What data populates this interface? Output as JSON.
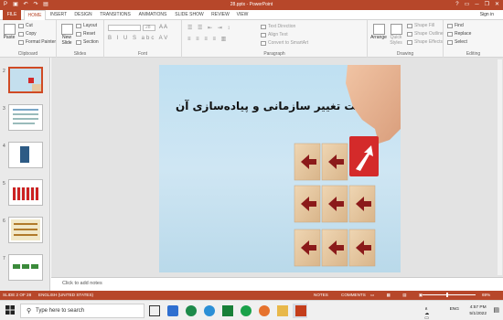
{
  "window": {
    "title": "28.pptx - PowerPoint",
    "minimize": "─",
    "restore": "❐",
    "close": "✕"
  },
  "tabs": [
    {
      "label": "FILE"
    },
    {
      "label": "HOME"
    },
    {
      "label": "INSERT"
    },
    {
      "label": "DESIGN"
    },
    {
      "label": "TRANSITIONS"
    },
    {
      "label": "ANIMATIONS"
    },
    {
      "label": "SLIDE SHOW"
    },
    {
      "label": "REVIEW"
    },
    {
      "label": "VIEW"
    }
  ],
  "active_tab": "HOME",
  "signin": "Sign in",
  "ribbon": {
    "clipboard": {
      "label": "Clipboard",
      "paste": "Paste",
      "cut": "Cut",
      "copy": "Copy",
      "format_painter": "Format Painter"
    },
    "slides": {
      "label": "Slides",
      "new_slide": "New Slide",
      "layout": "Layout",
      "reset": "Reset",
      "section": "Section"
    },
    "font": {
      "label": "Font",
      "size": "28"
    },
    "paragraph": {
      "label": "Paragraph",
      "text_direction": "Text Direction",
      "align_text": "Align Text",
      "convert_smartart": "Convert to SmartArt"
    },
    "drawing": {
      "label": "Drawing",
      "arrange": "Arrange",
      "quick_styles": "Quick Styles",
      "shape_fill": "Shape Fill",
      "shape_outline": "Shape Outline",
      "shape_effects": "Shape Effects"
    },
    "editing": {
      "label": "Editing",
      "find": "Find",
      "replace": "Replace",
      "select": "Select"
    }
  },
  "thumbnails": [
    {
      "num": "2",
      "selected": true
    },
    {
      "num": "3"
    },
    {
      "num": "4"
    },
    {
      "num": "5"
    },
    {
      "num": "6"
    },
    {
      "num": "7"
    }
  ],
  "slide": {
    "title": "مدیریت تغییر سازمانی و پیاده‌سازی آن"
  },
  "notes_placeholder": "Click to add notes",
  "status": {
    "slide_info": "SLIDE 2 OF 28",
    "language": "ENGLISH (UNITED STATES)",
    "notes": "NOTES",
    "comments": "COMMENTS",
    "zoom": "69%"
  },
  "taskbar": {
    "search_placeholder": "Type here to search",
    "lang": "ENG",
    "time": "4:57 PM",
    "date": "5/1/2022"
  },
  "colors": {
    "accent": "#b7472a",
    "arrow_red": "#8b1a1a",
    "cube_red": "#d42a2a",
    "wood": "#e6c9a2"
  }
}
